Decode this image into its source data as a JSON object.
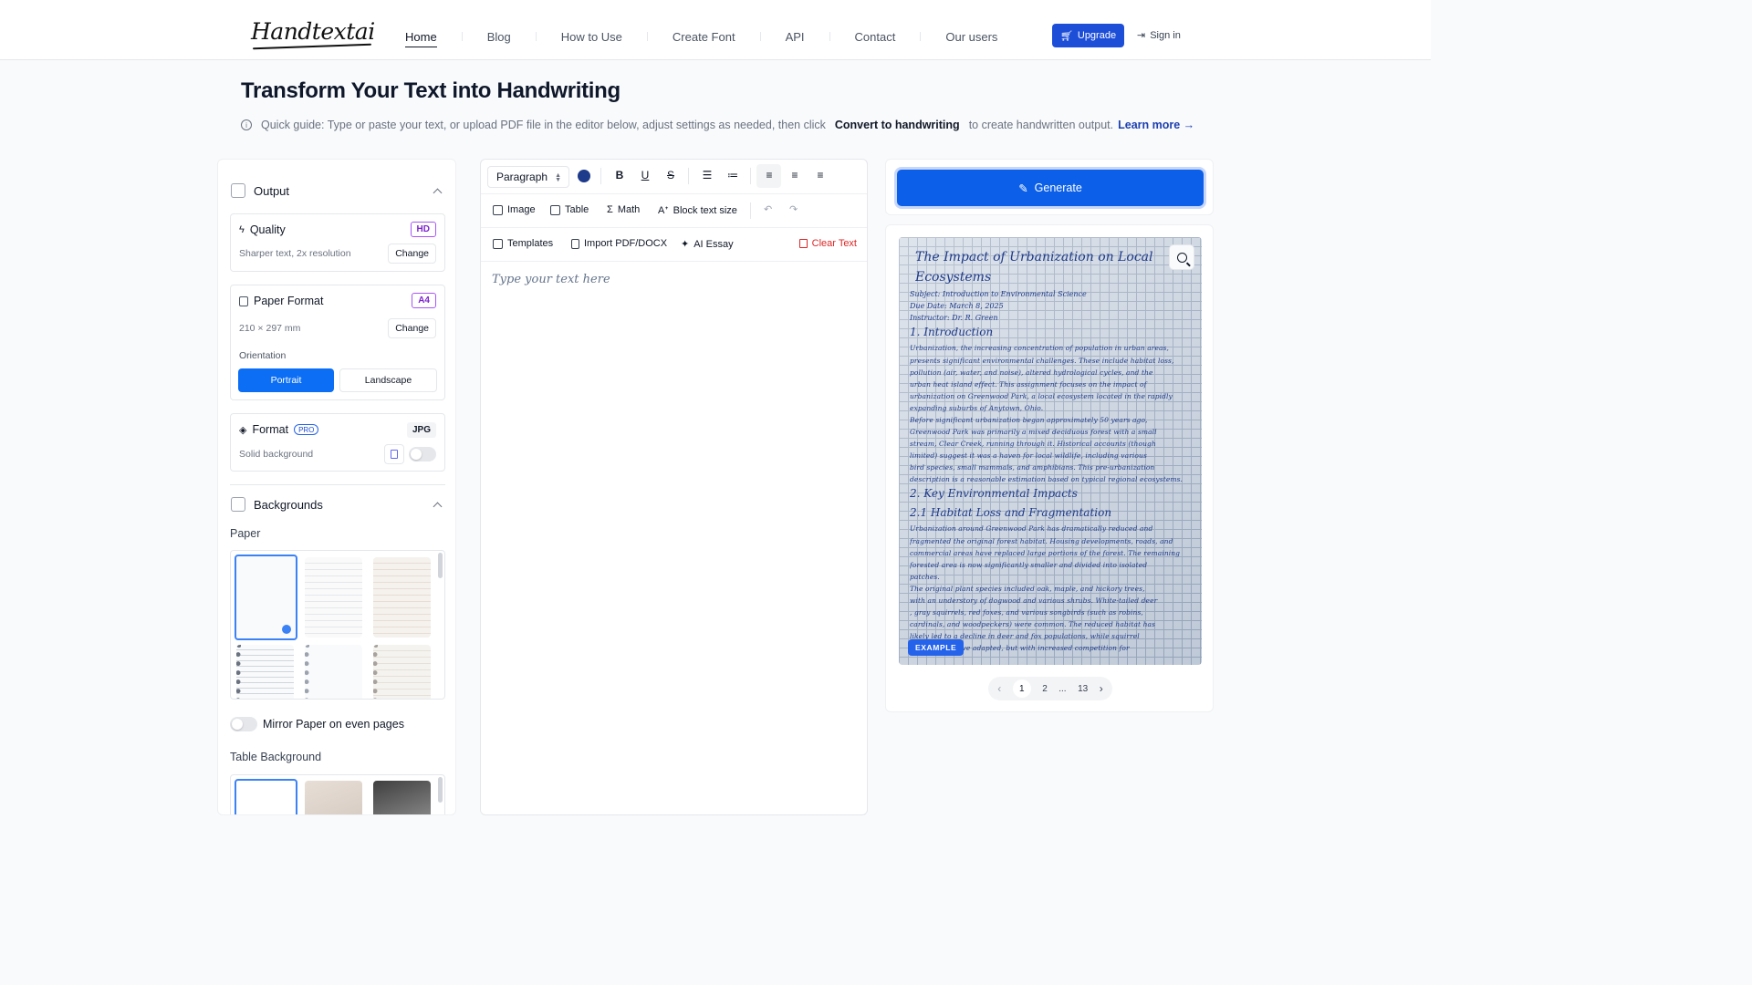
{
  "header": {
    "logo": "Handtextai",
    "nav": [
      {
        "label": "Home",
        "active": true
      },
      {
        "label": "Blog"
      },
      {
        "label": "How to Use"
      },
      {
        "label": "Create Font"
      },
      {
        "label": "API"
      },
      {
        "label": "Contact"
      },
      {
        "label": "Our users"
      }
    ],
    "upgrade_label": "Upgrade",
    "signin_label": "Sign in"
  },
  "page": {
    "title": "Transform Your Text into Handwriting",
    "guide_prefix": "Quick guide: Type or paste your text, or upload PDF file in the editor below, adjust settings as needed, then click",
    "guide_bold": "Convert to handwriting",
    "guide_suffix": "to create handwritten output.",
    "learn_more": "Learn more →"
  },
  "left_panel": {
    "output_title": "Output",
    "quality": {
      "title": "Quality",
      "badge": "HD",
      "desc": "Sharper text, 2x resolution",
      "button": "Change"
    },
    "paper_format": {
      "title": "Paper Format",
      "badge": "A4",
      "desc": "210 × 297 mm",
      "button": "Change"
    },
    "orientation": {
      "label": "Orientation",
      "options": [
        "Portrait",
        "Landscape"
      ],
      "selected": "Portrait"
    },
    "format": {
      "title": "Format",
      "pro": "PRO",
      "badge": "JPG",
      "desc": "Solid background"
    },
    "backgrounds_title": "Backgrounds",
    "paper_label": "Paper",
    "mirror_label": "Mirror Paper on even pages",
    "table_bg_label": "Table Background"
  },
  "editor": {
    "paragraph_select": "Paragraph",
    "text_color": "#1e3a8a",
    "row2": {
      "image": "Image",
      "table": "Table",
      "math": "Math",
      "block_text_size": "Block text size"
    },
    "row3": {
      "templates": "Templates",
      "import": "Import PDF/DOCX",
      "ai_essay": "AI Essay",
      "clear": "Clear Text"
    },
    "placeholder": "Type your text here"
  },
  "right_panel": {
    "generate_label": "Generate",
    "example_badge": "EXAMPLE",
    "preview_lines": [
      "The Impact of Urbanization on Local",
      "Ecosystems",
      "Subject: Introduction to Environmental Science",
      "Due Date: March 8, 2025",
      "Instructor: Dr. R. Green",
      "1. Introduction",
      "Urbanization, the increasing concentration of population in urban areas,",
      "presents significant environmental challenges. These include habitat loss,",
      "pollution (air, water, and noise), altered hydrological cycles, and the",
      "urban heat island effect. This assignment focuses on the impact of",
      "urbanization on Greenwood Park, a local ecosystem located in the rapidly",
      "expanding suburbs of Anytown, Ohio.",
      "Before significant urbanization began approximately 50 years ago,",
      "Greenwood Park was primarily a mixed deciduous forest with a small",
      "stream, Clear Creek, running through it. Historical accounts (though",
      "limited) suggest it was a haven for local wildlife, including various",
      "bird species, small mammals, and amphibians. This pre-urbanization",
      "description is a reasonable estimation based on typical regional ecosystems.",
      "2. Key Environmental Impacts",
      "2.1 Habitat Loss and Fragmentation",
      "Urbanization around Greenwood Park has dramatically reduced and",
      "fragmented the original forest habitat. Housing developments, roads, and",
      "commercial areas have replaced large portions of the forest. The remaining",
      "forested area is now significantly smaller and divided into isolated",
      "patches.",
      "The original plant species included oak, maple, and hickory trees,",
      "with an understory of dogwood and various shrubs. White-tailed deer",
      ", gray squirrels, red foxes, and various songbirds (such as robins,",
      "cardinals, and woodpeckers) were common. The reduced habitat has",
      "likely led to a decline in deer and fox populations, while squirrel",
      "populations have adapted, but with increased competition for"
    ],
    "pager": {
      "current": "1",
      "next": "2",
      "ellipsis": "...",
      "last": "13"
    }
  }
}
